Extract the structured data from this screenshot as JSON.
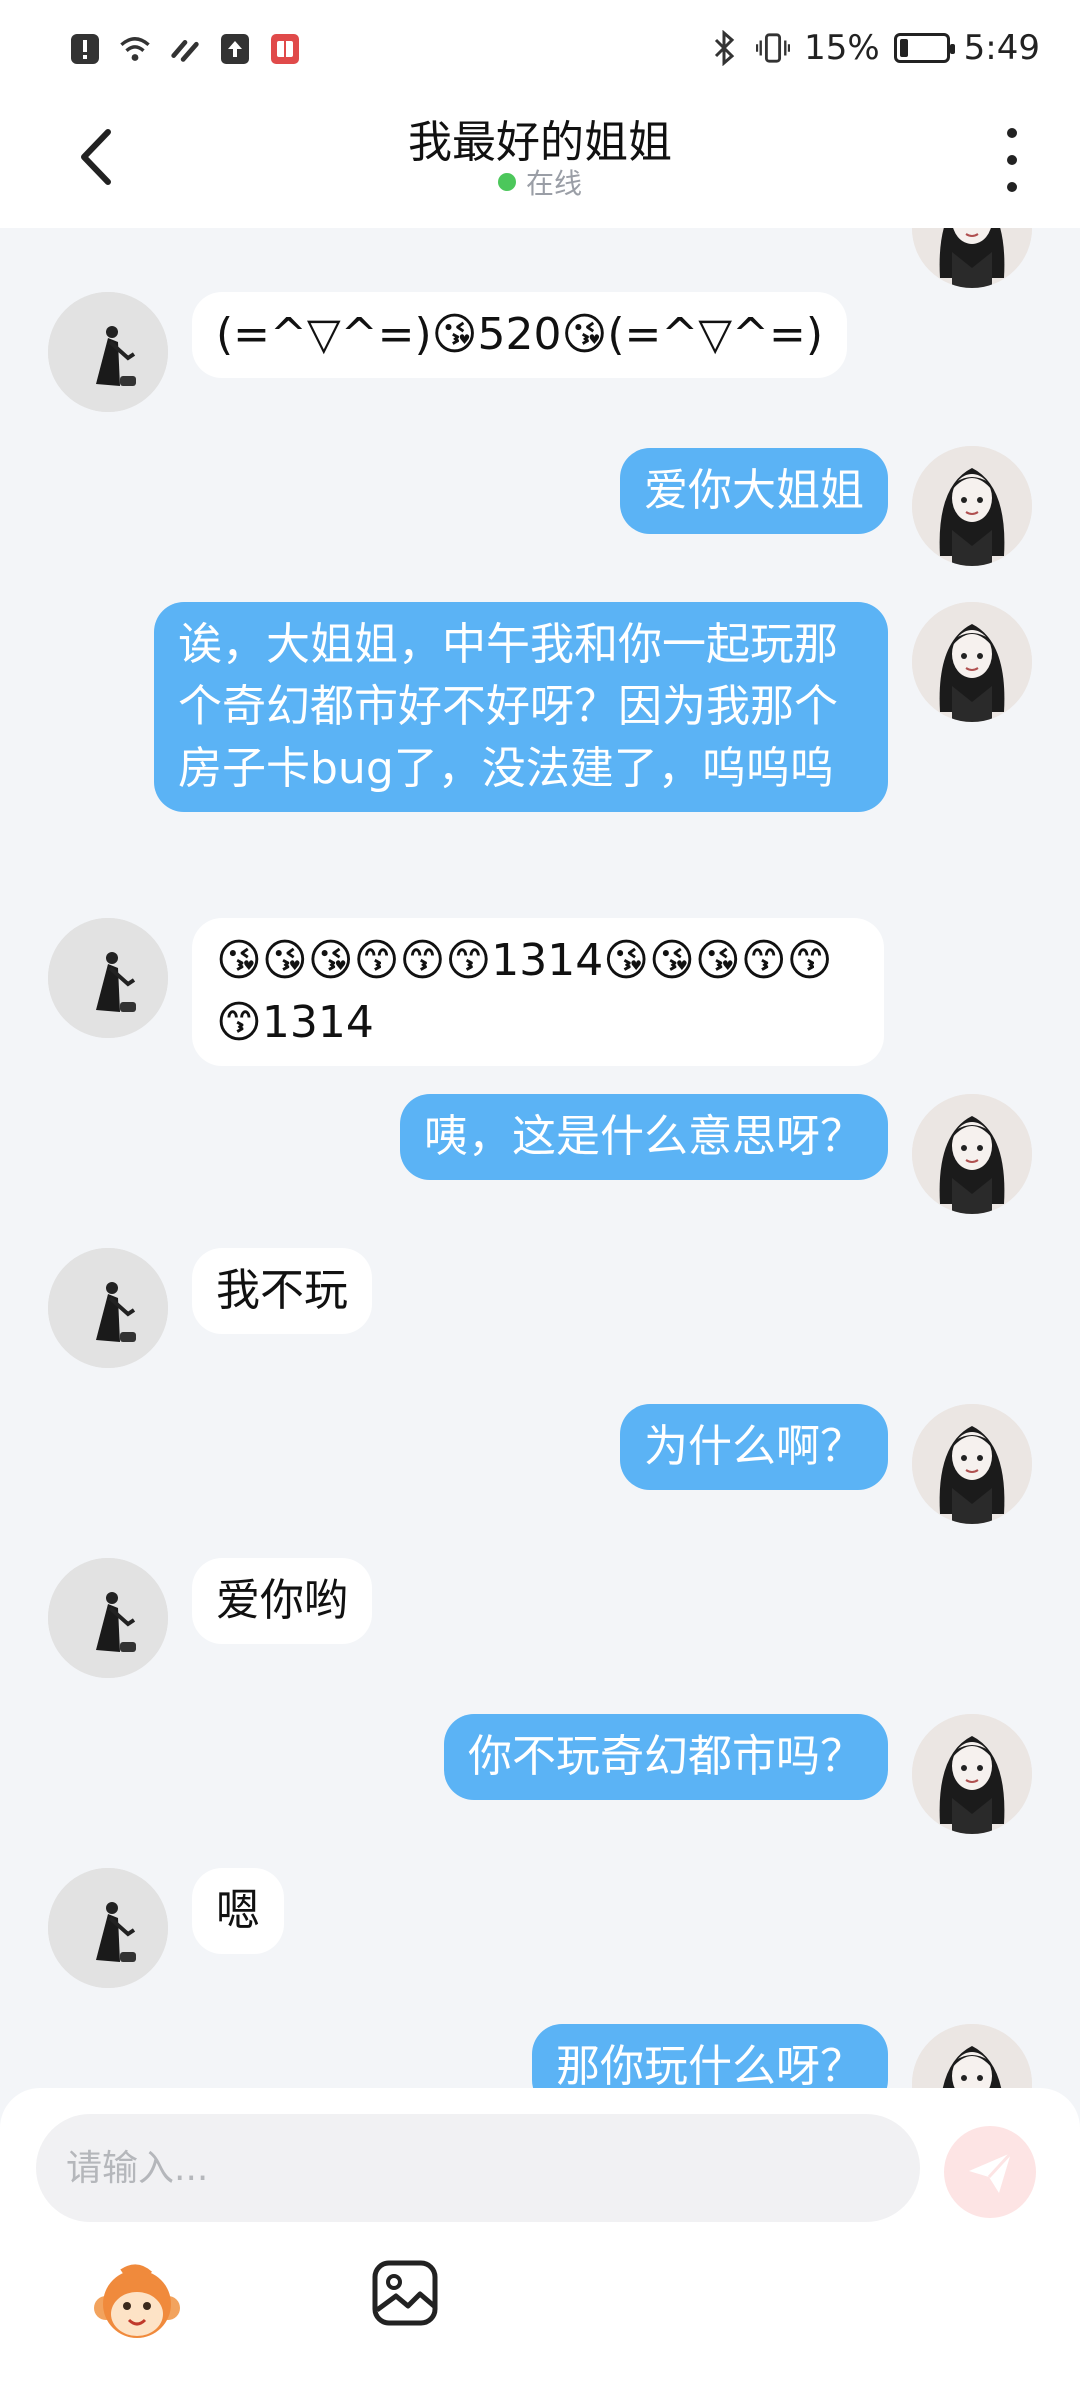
{
  "status_bar": {
    "battery_text": "15%",
    "battery_level": 0.15,
    "time": "5:49",
    "icons": [
      "alert-icon",
      "wifi-icon",
      "signal-icon",
      "upload-icon",
      "book-icon",
      "bluetooth-icon",
      "vibrate-icon",
      "battery-icon"
    ]
  },
  "header": {
    "title": "我最好的姐姐",
    "status": "在线",
    "status_color": "#4cc75b"
  },
  "messages": [
    {
      "from": "other",
      "text": "(=^▽^=)😘520😘(=^▽^=)"
    },
    {
      "from": "me",
      "text": "爱你大姐姐"
    },
    {
      "from": "me",
      "text": "诶，大姐姐，中午我和你一起玩那个奇幻都市好不好呀？因为我那个房子卡bug了，没法建了，呜呜呜"
    },
    {
      "from": "other",
      "text": "😘😘😘😙😙😙1314😘😘😘😙😙😙1314"
    },
    {
      "from": "me",
      "text": "咦，这是什么意思呀？"
    },
    {
      "from": "other",
      "text": "我不玩"
    },
    {
      "from": "me",
      "text": "为什么啊？"
    },
    {
      "from": "other",
      "text": "爱你哟"
    },
    {
      "from": "me",
      "text": "你不玩奇幻都市吗？"
    },
    {
      "from": "other",
      "text": "嗯"
    },
    {
      "from": "me",
      "text": "那你玩什么呀？"
    }
  ],
  "input": {
    "placeholder": "请输入...",
    "value": ""
  },
  "colors": {
    "my_bubble": "#5bb3f5",
    "other_bubble": "#ffffff",
    "background": "#f3f5f8",
    "send_button": "#fde4e4"
  }
}
